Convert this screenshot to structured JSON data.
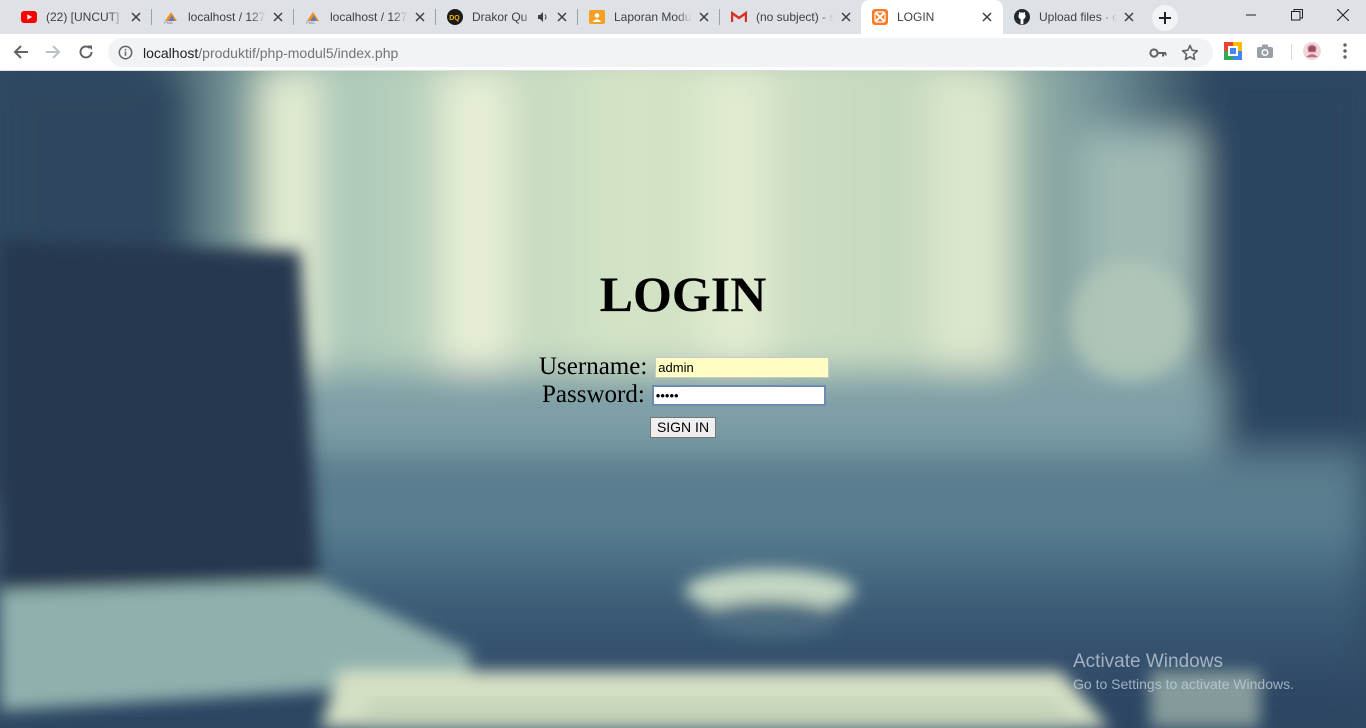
{
  "browser": {
    "tabs": [
      {
        "title": "(22) [UNCUT] 7",
        "icon": "youtube-icon",
        "active": false
      },
      {
        "title": "localhost / 127",
        "icon": "phpmyadmin-icon",
        "active": false
      },
      {
        "title": "localhost / 127",
        "icon": "phpmyadmin-icon",
        "active": false
      },
      {
        "title": "Drakor Qu",
        "icon": "drakor-icon",
        "active": false,
        "audio": true
      },
      {
        "title": "Laporan Modu",
        "icon": "google-classroom-icon",
        "active": false
      },
      {
        "title": "(no subject) - s",
        "icon": "gmail-icon",
        "active": false
      },
      {
        "title": "LOGIN",
        "icon": "xampp-icon",
        "active": true
      },
      {
        "title": "Upload files · c",
        "icon": "github-icon",
        "active": false
      }
    ],
    "address": {
      "host": "localhost",
      "path": "/produktif/php-modul5/index.php"
    }
  },
  "page": {
    "title": "LOGIN",
    "username_label": "Username:",
    "username_value": "admin",
    "password_label": "Password:",
    "password_value": "admin",
    "signin_label": "SIGN IN"
  },
  "watermark": {
    "line1": "Activate Windows",
    "line2": "Go to Settings to activate Windows."
  },
  "colors": {
    "tabstrip": "#dee1e6",
    "autofill": "#fdfdc4"
  }
}
